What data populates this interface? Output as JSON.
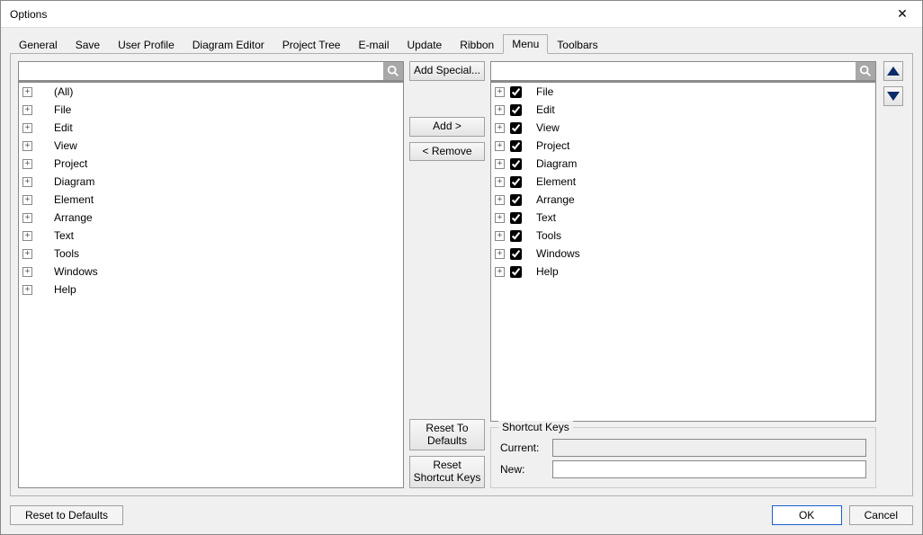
{
  "window": {
    "title": "Options"
  },
  "tabs": [
    "General",
    "Save",
    "User Profile",
    "Diagram Editor",
    "Project Tree",
    "E-mail",
    "Update",
    "Ribbon",
    "Menu",
    "Toolbars"
  ],
  "active_tab": "Menu",
  "left_search": {
    "value": "",
    "placeholder": ""
  },
  "right_search": {
    "value": "",
    "placeholder": ""
  },
  "left_tree": [
    "(All)",
    "File",
    "Edit",
    "View",
    "Project",
    "Diagram",
    "Element",
    "Arrange",
    "Text",
    "Tools",
    "Windows",
    "Help"
  ],
  "right_tree": [
    {
      "label": "File",
      "checked": true
    },
    {
      "label": "Edit",
      "checked": true
    },
    {
      "label": "View",
      "checked": true
    },
    {
      "label": "Project",
      "checked": true
    },
    {
      "label": "Diagram",
      "checked": true
    },
    {
      "label": "Element",
      "checked": true
    },
    {
      "label": "Arrange",
      "checked": true
    },
    {
      "label": "Text",
      "checked": true
    },
    {
      "label": "Tools",
      "checked": true
    },
    {
      "label": "Windows",
      "checked": true
    },
    {
      "label": "Help",
      "checked": true
    }
  ],
  "buttons": {
    "add_special": "Add Special...",
    "add": "Add >",
    "remove": "< Remove",
    "reset_defaults_small": "Reset To Defaults",
    "reset_shortcut": "Reset Shortcut Keys",
    "reset_defaults_big": "Reset to Defaults",
    "ok": "OK",
    "cancel": "Cancel"
  },
  "shortcut_keys": {
    "legend": "Shortcut Keys",
    "current_label": "Current:",
    "current_value": "",
    "new_label": "New:",
    "new_value": ""
  }
}
